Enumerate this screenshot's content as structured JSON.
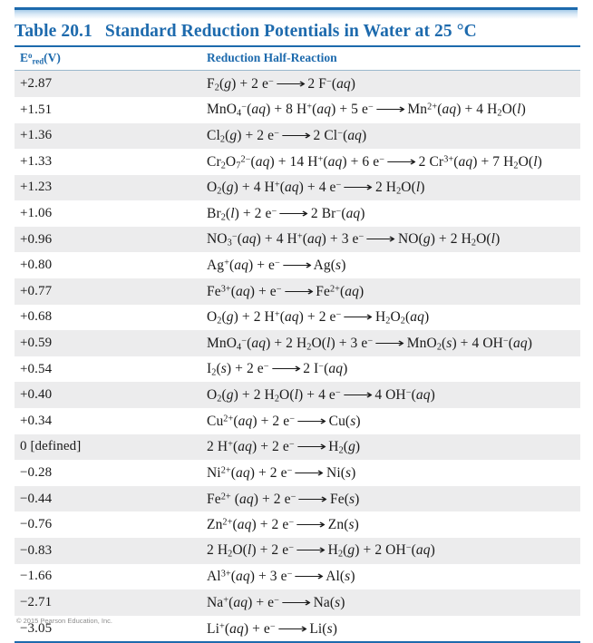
{
  "document": {
    "title_number": "Table 20.1",
    "title_text": "Standard Reduction Potentials in Water at 25 °C",
    "credit": "© 2015 Pearson Education, Inc."
  },
  "table": {
    "columns": [
      {
        "key": "potential",
        "label_html": "E<sup>o</sup><sub>red</sub>(V)",
        "label_plain": "E°red(V)"
      },
      {
        "key": "reaction",
        "label_html": "Reduction Half-Reaction",
        "label_plain": "Reduction Half-Reaction"
      }
    ],
    "rows": [
      {
        "potential": "+2.87",
        "reaction_plain": "F2(g) + 2 e- ⟶ 2 F-(aq)",
        "reaction_html": "F<sub>2</sub>(<span class='it'>g</span>) + 2 e<sup>−</sup> <span class='arrow'>⟶</span> 2 F<sup>−</sup>(<span class='it'>aq</span>)"
      },
      {
        "potential": "+1.51",
        "reaction_plain": "MnO4-(aq) + 8 H+(aq) + 5 e- ⟶ Mn2+(aq) + 4 H2O(l)",
        "reaction_html": "MnO<sub>4</sub><sup>−</sup>(<span class='it'>aq</span>) + 8 H<sup>+</sup>(<span class='it'>aq</span>) + 5 e<sup>−</sup> <span class='arrow'>⟶</span> Mn<sup>2+</sup>(<span class='it'>aq</span>) + 4 H<sub>2</sub>O(<span class='it'>l</span>)"
      },
      {
        "potential": "+1.36",
        "reaction_plain": "Cl2(g) + 2 e- ⟶ 2 Cl-(aq)",
        "reaction_html": "Cl<sub>2</sub>(<span class='it'>g</span>) + 2 e<sup>−</sup> <span class='arrow'>⟶</span> 2 Cl<sup>−</sup>(<span class='it'>aq</span>)"
      },
      {
        "potential": "+1.33",
        "reaction_plain": "Cr2O7 2-(aq) + 14 H+(aq) + 6 e- ⟶ 2 Cr3+(aq) + 7 H2O(l)",
        "reaction_html": "Cr<sub>2</sub>O<sub>7</sub><sup>2−</sup>(<span class='it'>aq</span>) + 14 H<sup>+</sup>(<span class='it'>aq</span>) + 6 e<sup>−</sup> <span class='arrow'>⟶</span> 2 Cr<sup>3+</sup>(<span class='it'>aq</span>) + 7 H<sub>2</sub>O(<span class='it'>l</span>)"
      },
      {
        "potential": "+1.23",
        "reaction_plain": "O2(g) + 4 H+(aq) + 4 e- ⟶ 2 H2O(l)",
        "reaction_html": "O<sub>2</sub>(<span class='it'>g</span>) + 4 H<sup>+</sup>(<span class='it'>aq</span>) + 4 e<sup>−</sup> <span class='arrow'>⟶</span> 2 H<sub>2</sub>O(<span class='it'>l</span>)"
      },
      {
        "potential": "+1.06",
        "reaction_plain": "Br2(l) + 2 e- ⟶ 2 Br-(aq)",
        "reaction_html": "Br<sub>2</sub>(<span class='it'>l</span>) + 2 e<sup>−</sup> <span class='arrow'>⟶</span> 2 Br<sup>−</sup>(<span class='it'>aq</span>)"
      },
      {
        "potential": "+0.96",
        "reaction_plain": "NO3-(aq) + 4 H+(aq) + 3 e- ⟶ NO(g) + 2 H2O(l)",
        "reaction_html": "NO<sub>3</sub><sup>−</sup>(<span class='it'>aq</span>) + 4 H<sup>+</sup>(<span class='it'>aq</span>) + 3 e<sup>−</sup> <span class='arrow'>⟶</span> NO(<span class='it'>g</span>) + 2 H<sub>2</sub>O(<span class='it'>l</span>)"
      },
      {
        "potential": "+0.80",
        "reaction_plain": "Ag+(aq) + e- ⟶ Ag(s)",
        "reaction_html": "Ag<sup>+</sup>(<span class='it'>aq</span>) + e<sup>−</sup> <span class='arrow'>⟶</span> Ag(<span class='it'>s</span>)"
      },
      {
        "potential": "+0.77",
        "reaction_plain": "Fe3+(aq) + e- ⟶ Fe2+(aq)",
        "reaction_html": "Fe<sup>3+</sup>(<span class='it'>aq</span>) + e<sup>−</sup> <span class='arrow'>⟶</span> Fe<sup>2+</sup>(<span class='it'>aq</span>)"
      },
      {
        "potential": "+0.68",
        "reaction_plain": "O2(g) + 2 H+(aq) + 2 e- ⟶ H2O2(aq)",
        "reaction_html": "O<sub>2</sub>(<span class='it'>g</span>) + 2 H<sup>+</sup>(<span class='it'>aq</span>) + 2 e<sup>−</sup> <span class='arrow'>⟶</span> H<sub>2</sub>O<sub>2</sub>(<span class='it'>aq</span>)"
      },
      {
        "potential": "+0.59",
        "reaction_plain": "MnO4-(aq) + 2 H2O(l) + 3 e- ⟶ MnO2(s) + 4 OH-(aq)",
        "reaction_html": "MnO<sub>4</sub><sup>−</sup>(<span class='it'>aq</span>) + 2 H<sub>2</sub>O(<span class='it'>l</span>) + 3 e<sup>−</sup> <span class='arrow'>⟶</span> MnO<sub>2</sub>(<span class='it'>s</span>) + 4 OH<sup>−</sup>(<span class='it'>aq</span>)"
      },
      {
        "potential": "+0.54",
        "reaction_plain": "I2(s) + 2 e- ⟶ 2 I-(aq)",
        "reaction_html": "I<sub>2</sub>(<span class='it'>s</span>) + 2 e<sup>−</sup> <span class='arrow'>⟶</span> 2 I<sup>−</sup>(<span class='it'>aq</span>)"
      },
      {
        "potential": "+0.40",
        "reaction_plain": "O2(g) + 2 H2O(l) + 4 e- ⟶ 4 OH-(aq)",
        "reaction_html": "O<sub>2</sub>(<span class='it'>g</span>) + 2 H<sub>2</sub>O(<span class='it'>l</span>) + 4 e<sup>−</sup> <span class='arrow'>⟶</span> 4 OH<sup>−</sup>(<span class='it'>aq</span>)"
      },
      {
        "potential": "+0.34",
        "reaction_plain": "Cu2+(aq) + 2 e- ⟶ Cu(s)",
        "reaction_html": "Cu<sup>2+</sup>(<span class='it'>aq</span>) + 2 e<sup>−</sup> <span class='arrow'>⟶</span> Cu(<span class='it'>s</span>)"
      },
      {
        "potential": "0 [defined]",
        "reaction_plain": "2 H+(aq) + 2 e- ⟶ H2(g)",
        "reaction_html": "2 H<sup>+</sup>(<span class='it'>aq</span>) + 2 e<sup>−</sup> <span class='arrow'>⟶</span> H<sub>2</sub>(<span class='it'>g</span>)"
      },
      {
        "potential": "−0.28",
        "reaction_plain": "Ni2+(aq) + 2 e- ⟶ Ni(s)",
        "reaction_html": "Ni<sup>2+</sup>(<span class='it'>aq</span>) + 2 e<sup>−</sup> <span class='arrow'>⟶</span> Ni(<span class='it'>s</span>)"
      },
      {
        "potential": "−0.44",
        "reaction_plain": "Fe2+(aq) + 2 e- ⟶ Fe(s)",
        "reaction_html": "Fe<sup>2+</sup> (<span class='it'>aq</span>) + 2 e<sup>−</sup> <span class='arrow'>⟶</span> Fe(<span class='it'>s</span>)"
      },
      {
        "potential": "−0.76",
        "reaction_plain": "Zn2+(aq) + 2 e- ⟶ Zn(s)",
        "reaction_html": "Zn<sup>2+</sup>(<span class='it'>aq</span>) + 2 e<sup>−</sup> <span class='arrow'>⟶</span> Zn(<span class='it'>s</span>)"
      },
      {
        "potential": "−0.83",
        "reaction_plain": "2 H2O(l) + 2 e- ⟶ H2(g) + 2 OH-(aq)",
        "reaction_html": "2 H<sub>2</sub>O(<span class='it'>l</span>) + 2 e<sup>−</sup> <span class='arrow'>⟶</span> H<sub>2</sub>(<span class='it'>g</span>) + 2 OH<sup>−</sup>(<span class='it'>aq</span>)"
      },
      {
        "potential": "−1.66",
        "reaction_plain": "Al3+(aq) + 3 e- ⟶ Al(s)",
        "reaction_html": "Al<sup>3+</sup>(<span class='it'>aq</span>) + 3 e<sup>−</sup> <span class='arrow'>⟶</span> Al(<span class='it'>s</span>)"
      },
      {
        "potential": "−2.71",
        "reaction_plain": "Na+(aq) + e- ⟶ Na(s)",
        "reaction_html": "Na<sup>+</sup>(<span class='it'>aq</span>) + e<sup>−</sup> <span class='arrow'>⟶</span> Na(<span class='it'>s</span>)"
      },
      {
        "potential": "−3.05",
        "reaction_plain": "Li+(aq) + e- ⟶ Li(s)",
        "reaction_html": "Li<sup>+</sup>(<span class='it'>aq</span>) + e<sup>−</sup> <span class='arrow'>⟶</span> Li(<span class='it'>s</span>)"
      }
    ]
  },
  "colors": {
    "accent_blue": "#1d6aad",
    "row_shade": "#ececed",
    "text": "#1a1a1a",
    "credit_gray": "#8d8d8d"
  }
}
